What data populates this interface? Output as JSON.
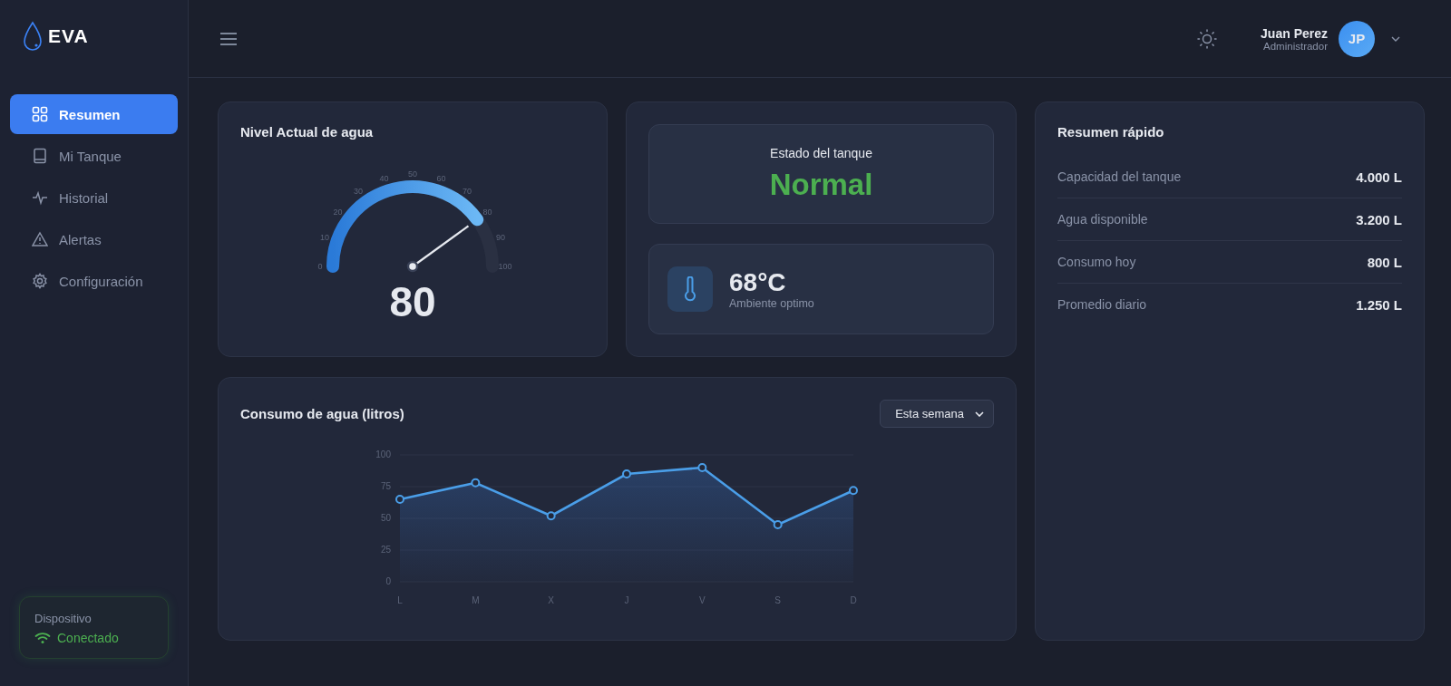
{
  "brand": {
    "name": "EVA"
  },
  "sidebar": {
    "items": [
      {
        "label": "Resumen",
        "selected": true
      },
      {
        "label": "Mi Tanque",
        "selected": false
      },
      {
        "label": "Historial",
        "selected": false
      },
      {
        "label": "Alertas",
        "selected": false
      },
      {
        "label": "Configuración",
        "selected": false
      }
    ],
    "device": {
      "label": "Dispositivo",
      "status": "Conectado",
      "connected": true
    }
  },
  "header": {
    "user": {
      "name": "Juan Perez",
      "role": "Administrador",
      "initials": "JP"
    }
  },
  "water_level": {
    "title": "Nivel Actual de agua",
    "value": "80",
    "level": 0.8,
    "ticks": [
      "0",
      "10",
      "20",
      "30",
      "40",
      "50",
      "60",
      "70",
      "80",
      "90",
      "100"
    ]
  },
  "tank_state": {
    "title": "Estado del tanque",
    "value": "Normal"
  },
  "temperature": {
    "value": "68°C",
    "caption": "Ambiente optimo"
  },
  "quick_summary": {
    "title": "Resumen rápido",
    "rows": [
      {
        "label": "Capacidad del tanque",
        "value": "4.000 L"
      },
      {
        "label": "Agua disponible",
        "value": "3.200 L"
      },
      {
        "label": "Consumo hoy",
        "value": "800 L"
      },
      {
        "label": "Promedio diario",
        "value": "1.250 L"
      }
    ]
  },
  "consumption": {
    "title": "Consumo de agua (litros)",
    "period": "Esta semana",
    "chart_data": {
      "type": "area",
      "categories": [
        "L",
        "M",
        "X",
        "J",
        "V",
        "S",
        "D"
      ],
      "series": [
        {
          "color": "#4a9ee8",
          "values": [
            65,
            78,
            52,
            85,
            90,
            45,
            72
          ]
        }
      ],
      "ylim": [
        0,
        100
      ],
      "yticks": [
        0,
        25,
        50,
        75,
        100
      ],
      "grid": true
    }
  }
}
